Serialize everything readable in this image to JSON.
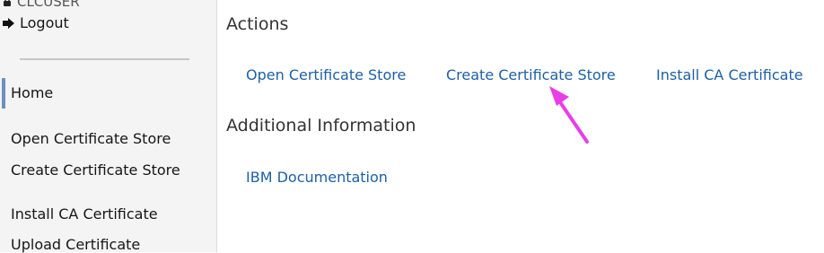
{
  "sidebar": {
    "user": "CLCUSER",
    "logout": "Logout",
    "home": "Home",
    "items": [
      {
        "label": "Open Certificate Store"
      },
      {
        "label": "Create Certificate Store"
      },
      {
        "label": "Install CA Certificate"
      },
      {
        "label": "Upload Certificate"
      }
    ]
  },
  "main": {
    "actions_heading": "Actions",
    "actions": [
      {
        "label": "Open Certificate Store"
      },
      {
        "label": "Create Certificate Store"
      },
      {
        "label": "Install CA Certificate"
      }
    ],
    "info_heading": "Additional Information",
    "info_links": [
      {
        "label": "IBM Documentation"
      }
    ]
  },
  "colors": {
    "link": "#1d5fa6",
    "sidebar_bg": "#f4f4f4",
    "active_indicator": "#6f8fc0",
    "annotation_arrow": "#e83ee8"
  },
  "icons": {
    "user": "lock-icon",
    "logout": "logout-icon",
    "annotation": "pointer-arrow-icon"
  }
}
